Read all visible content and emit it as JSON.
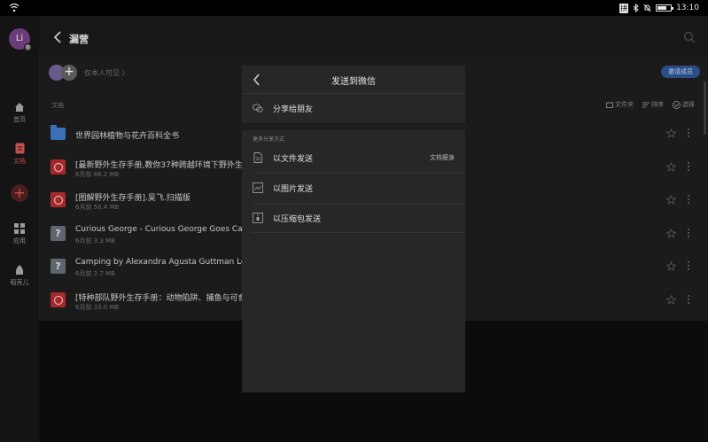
{
  "status_bar": {
    "time": "13:10",
    "ime_label": "拼",
    "battery_level": 0.7
  },
  "sidebar": {
    "avatar_initials": "Li",
    "items": [
      {
        "label": "首页",
        "icon": "home-icon",
        "active": false
      },
      {
        "label": "文档",
        "icon": "document-icon",
        "active": true
      },
      {
        "label": "应用",
        "icon": "grid-icon",
        "active": false
      },
      {
        "label": "稻壳儿",
        "icon": "leaf-icon",
        "active": false
      }
    ],
    "add_label": "+"
  },
  "header": {
    "title": "漏营"
  },
  "owner": {
    "text": "仅本人可见 〉",
    "add_label": "+"
  },
  "manage_button": "邀请成员",
  "list_label": "文档",
  "toolbar": {
    "new_folder": "文件夹",
    "sort": "排序",
    "select": "选择"
  },
  "files": [
    {
      "name": "世界园林植物与花卉百科全书",
      "meta": "",
      "type": "folder"
    },
    {
      "name": "[最新野外生存手册,教你37种跨越环境下野外生存",
      "meta": "6月前    86.2 MB",
      "type": "pdf"
    },
    {
      "name": "[图解野外生存手册].吴飞.扫描版",
      "meta": "6月前    50.4 MB",
      "type": "pdf"
    },
    {
      "name": "Curious George - Curious George Goes Camp",
      "meta": "6月前    3.3 MB",
      "type": "unknown"
    },
    {
      "name": "Camping by Alexandra Agusta Guttman Lock",
      "meta": "6月前    2.7 MB",
      "type": "unknown"
    },
    {
      "name": "[特种部队野外生存手册：动物陷阱、捕鱼与可食",
      "meta": "6月前    33.0 MB",
      "type": "pdf"
    }
  ],
  "dialog": {
    "title": "发送到微信",
    "share_friend": "分享给朋友",
    "section_label": "更多分享方式",
    "options": [
      {
        "label": "以文件发送",
        "tag": "文档瘦身",
        "icon": "file-icon"
      },
      {
        "label": "以图片发送",
        "tag": "",
        "icon": "image-icon"
      },
      {
        "label": "以压缩包发送",
        "tag": "",
        "icon": "zip-icon"
      }
    ]
  },
  "colors": {
    "accent_red": "#c0504d",
    "pdf_red": "#a5292b",
    "folder_blue": "#3b6fb6",
    "pill_blue": "#2c4d86"
  }
}
